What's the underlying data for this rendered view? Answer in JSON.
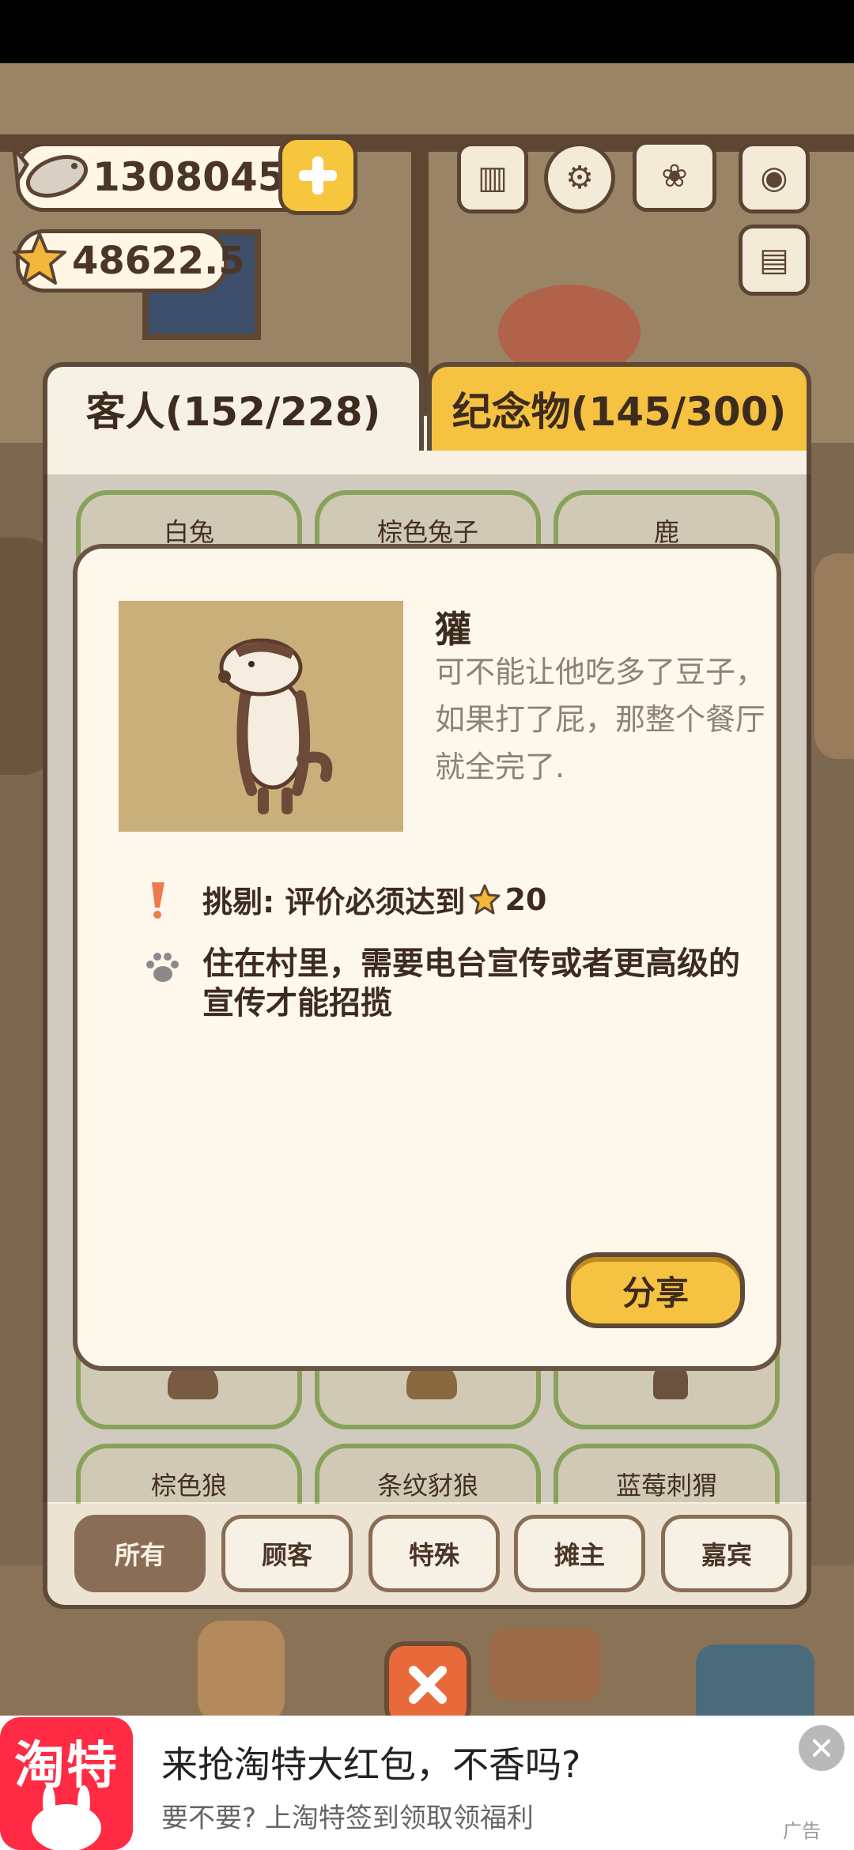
{
  "currency": {
    "fish": "13080450",
    "stars": "48622.5"
  },
  "tabs": {
    "guests": "客人(152/228)",
    "souvenirs": "纪念物(145/300)"
  },
  "cards_top": [
    "白兔",
    "棕色兔子",
    "鹿"
  ],
  "cards_bottom": [
    "棕色狼",
    "条纹豺狼",
    "蓝莓刺猬"
  ],
  "filters": [
    "所有",
    "顾客",
    "特殊",
    "摊主",
    "嘉宾"
  ],
  "detail": {
    "name": "獾",
    "description": "可不能让他吃多了豆子，如果打了屁，那整个餐厅就全完了.",
    "requirement_prefix": "挑剔: 评价必须达到",
    "requirement_value": "20",
    "habitat": "住在村里，需要电台宣传或者更高级的宣传才能招揽",
    "share_label": "分享"
  },
  "ad": {
    "logo_text": "淘特",
    "title": "来抢淘特大红包，不香吗?",
    "subtitle": "要不要? 上淘特签到领取领福利",
    "label": "广告"
  },
  "colors": {
    "accent_yellow": "#f5c242",
    "panel_border": "#5e4a39",
    "card_border": "#9fc06a",
    "ad_red": "#ff2a43"
  },
  "icons": [
    "fish-icon",
    "star-icon",
    "plus-icon",
    "ranking-icon",
    "settings-gear-icon",
    "guestbook-icon",
    "camera-icon",
    "newspaper-icon",
    "exclamation-icon",
    "paw-icon",
    "close-x-icon"
  ]
}
